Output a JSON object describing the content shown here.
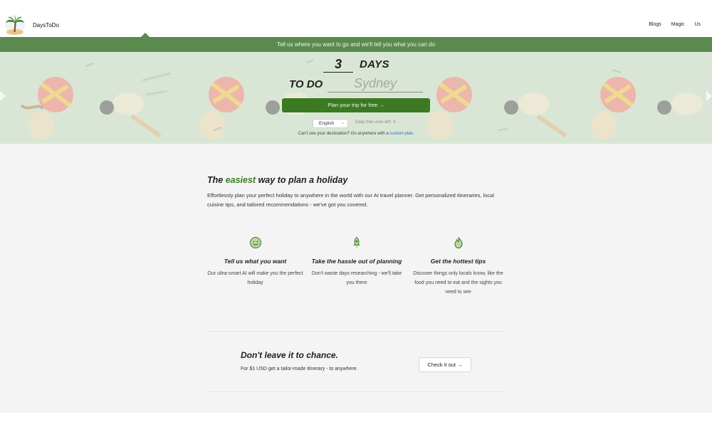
{
  "header": {
    "brand": "DaysToDo",
    "nav": [
      "Blogs",
      "Magic",
      "Us"
    ]
  },
  "banner": {
    "text": "Tell us where you want to go and we'll tell you what you can do"
  },
  "hero": {
    "days_value": "3",
    "days_label": "DAYS",
    "todo_label": "TO DO",
    "destination_placeholder": "Sydney",
    "plan_button": "Plan your trip for free →",
    "language_selected": "English",
    "free_uses": "Daily free uses left: 3",
    "cant_see_prefix": "Can't see your destination? Go anywhere with a ",
    "cant_see_link": "custom plan",
    "cant_see_suffix": "."
  },
  "main": {
    "headline_pre": "The ",
    "headline_accent": "easiest",
    "headline_post": " way to plan a holiday",
    "intro": "Effortlessly plan your perfect holiday to anywhere in the world with our AI travel planner. Get personalized itineraries, local cuisine tips, and tailored recommendations - we've got you covered.",
    "features": [
      {
        "icon": "smile-icon",
        "title": "Tell us what you want",
        "text": "Our ultra-smart AI will make you the perfect holiday"
      },
      {
        "icon": "rocket-icon",
        "title": "Take the hassle out of planning",
        "text": "Don't waste days researching - we'll take you there"
      },
      {
        "icon": "flame-icon",
        "title": "Get the hottest tips",
        "text": "Discover things only locals know, like the food you need to eat and the sights you need to see"
      }
    ],
    "chance_title": "Don't leave it to chance.",
    "chance_text": "For $1 USD get a tailor-made itinerary - to anywhere.",
    "check_button": "Check it out →"
  },
  "colors": {
    "brand_green": "#5b8a4e",
    "button_green": "#3b7a22",
    "hero_bg": "#d9e6d5",
    "link_blue": "#2a6fbb"
  }
}
